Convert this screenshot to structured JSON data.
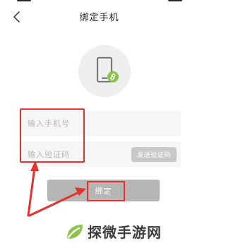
{
  "header": {
    "title": "绑定手机"
  },
  "icons": {
    "back": "back-chevron-icon",
    "phone": "phone-link-icon",
    "logo": "leaf-logo-icon"
  },
  "form": {
    "phone_placeholder": "输入手机号",
    "code_placeholder": "输入验证码",
    "send_code_label": "发送验证码",
    "submit_label": "绑定"
  },
  "watermark": {
    "text": "探微手游网"
  },
  "colors": {
    "annotation_red": "#e5322d",
    "accent_green": "#8bc34a",
    "button_gray": "#b5b5b5"
  }
}
